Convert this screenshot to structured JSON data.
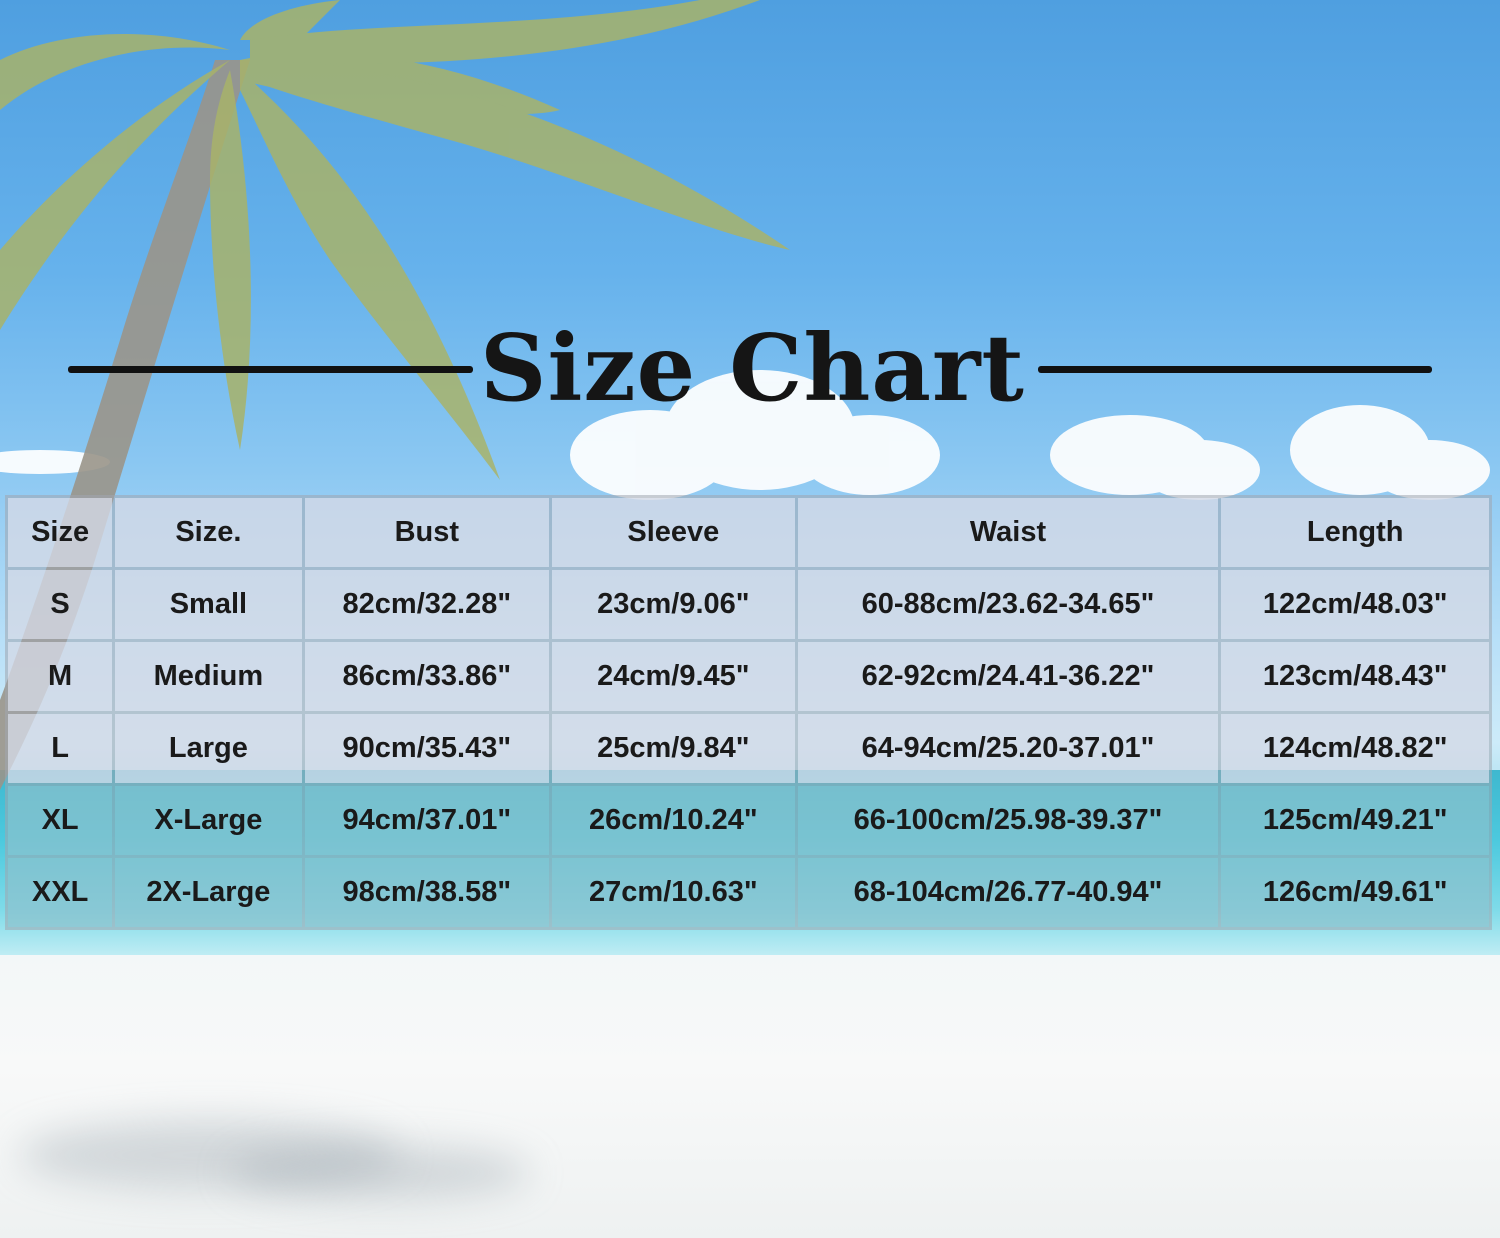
{
  "title": "Size Chart",
  "table": {
    "headers": [
      "Size",
      "Size.",
      "Bust",
      "Sleeve",
      "Waist",
      "Length"
    ],
    "rows": [
      [
        "S",
        "Small",
        "82cm/32.28\"",
        "23cm/9.06\"",
        "60-88cm/23.62-34.65\"",
        "122cm/48.03\""
      ],
      [
        "M",
        "Medium",
        "86cm/33.86\"",
        "24cm/9.45\"",
        "62-92cm/24.41-36.22\"",
        "123cm/48.43\""
      ],
      [
        "L",
        "Large",
        "90cm/35.43\"",
        "25cm/9.84\"",
        "64-94cm/25.20-37.01\"",
        "124cm/48.82\""
      ],
      [
        "XL",
        "X-Large",
        "94cm/37.01\"",
        "26cm/10.24\"",
        "66-100cm/25.98-39.37\"",
        "125cm/49.21\""
      ],
      [
        "XXL",
        "2X-Large",
        "98cm/38.58\"",
        "27cm/10.63\"",
        "68-104cm/26.77-40.94\"",
        "126cm/49.61\""
      ]
    ]
  },
  "colors": {
    "sky": "#66b2ec",
    "sea": "#4cc9de",
    "sand": "#f3f7f8",
    "title": "#151515"
  }
}
